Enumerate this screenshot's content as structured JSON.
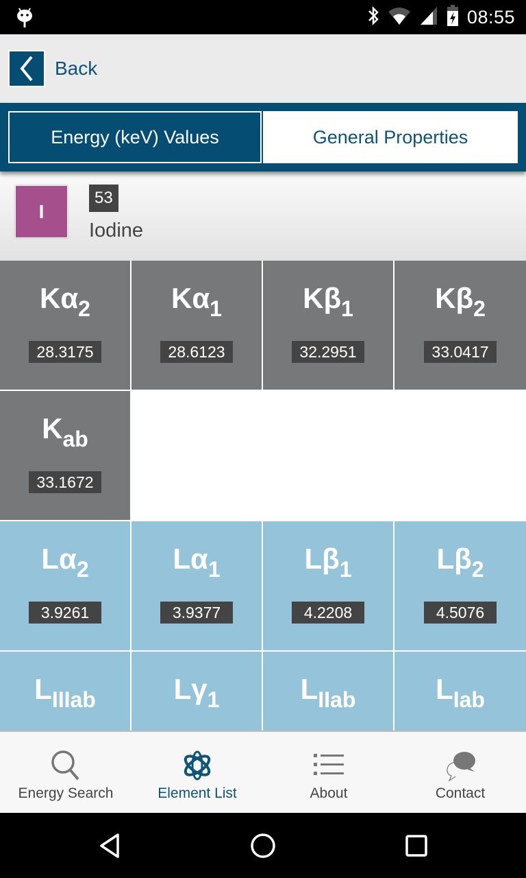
{
  "status_bar": {
    "time": "08:55",
    "icons": [
      "android-debug-icon",
      "bluetooth-icon",
      "wifi-icon",
      "cell-signal-icon",
      "battery-charging-icon"
    ]
  },
  "nav": {
    "back_label": "Back"
  },
  "tabs": [
    {
      "label": "Energy (keV) Values",
      "active": true
    },
    {
      "label": "General Properties",
      "active": false
    }
  ],
  "element": {
    "symbol": "I",
    "atomic_number": "53",
    "name": "Iodine",
    "symbol_color": "#a54f8c"
  },
  "energy_lines": {
    "k": [
      {
        "base": "Kα",
        "sub": "2",
        "value": "28.3175"
      },
      {
        "base": "Kα",
        "sub": "1",
        "value": "28.6123"
      },
      {
        "base": "Kβ",
        "sub": "1",
        "value": "32.2951"
      },
      {
        "base": "Kβ",
        "sub": "2",
        "value": "33.0417"
      },
      {
        "base": "K",
        "sub": "ab",
        "value": "33.1672"
      }
    ],
    "l": [
      {
        "base": "Lα",
        "sub": "2",
        "value": "3.9261"
      },
      {
        "base": "Lα",
        "sub": "1",
        "value": "3.9377"
      },
      {
        "base": "Lβ",
        "sub": "1",
        "value": "4.2208"
      },
      {
        "base": "Lβ",
        "sub": "2",
        "value": "4.5076"
      },
      {
        "base": "L",
        "sub": "IIIab",
        "value": ""
      },
      {
        "base": "Lγ",
        "sub": "1",
        "value": ""
      },
      {
        "base": "L",
        "sub": "IIab",
        "value": ""
      },
      {
        "base": "L",
        "sub": "Iab",
        "value": ""
      }
    ],
    "k_color": "#76787a",
    "l_color": "#95c3d9"
  },
  "bottom_nav": [
    {
      "label": "Energy Search",
      "icon": "search-icon",
      "active": false
    },
    {
      "label": "Element List",
      "icon": "atom-icon",
      "active": true
    },
    {
      "label": "About",
      "icon": "list-icon",
      "active": false
    },
    {
      "label": "Contact",
      "icon": "chat-bubble-icon",
      "active": false
    }
  ],
  "theme": {
    "primary": "#054d73",
    "primary_text": "#0d5478"
  }
}
